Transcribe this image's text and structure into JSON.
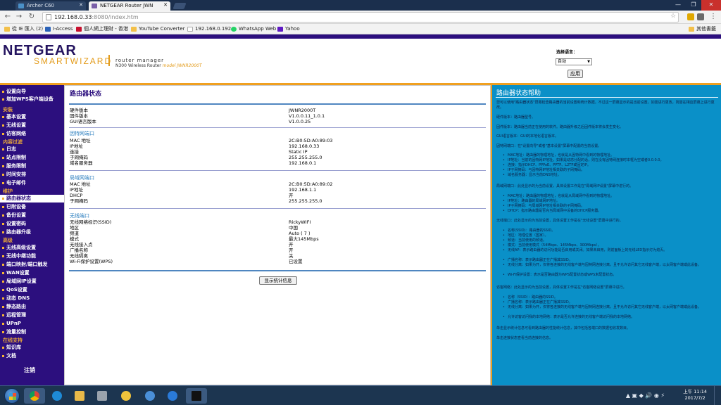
{
  "browser": {
    "tabs": [
      {
        "label": "Archer C60"
      },
      {
        "label": "NETGEAR Router JWN"
      }
    ],
    "url_host": "192.168.0.33",
    "url_path": ":8080/index.htm",
    "bookmarks": [
      {
        "label": "從 IE 匯入 (2)",
        "color": "#f3c04a"
      },
      {
        "label": "I-Access",
        "color": "#2b62b8"
      },
      {
        "label": "個人網上理財 - 香港",
        "color": "#c8102e"
      },
      {
        "label": "YouTube Converter",
        "color": "#f3c04a"
      },
      {
        "label": "192.168.0.192",
        "color": "#aaaaaa"
      },
      {
        "label": "WhatsApp Web",
        "color": "#25d366"
      },
      {
        "label": "Yahoo",
        "color": "#5f1ac4"
      },
      {
        "label": "其他書籤",
        "color": "#f3c04a"
      }
    ]
  },
  "router": {
    "brand": "NETGEAR",
    "sub_brand": "SMARTWIZARD",
    "tagline": "router manager",
    "model_desc": "N300 Wireless Router",
    "model_label": "model JWNR2000T",
    "language_label": "选择语言：",
    "language_value": "自动",
    "apply_label": "应用",
    "logout_label": "注销"
  },
  "sidebar": {
    "items": [
      {
        "label": "设置向导",
        "type": "item"
      },
      {
        "label": "增加WPS客户端设备",
        "type": "item"
      },
      {
        "label": "安装",
        "type": "head"
      },
      {
        "label": "基本设置",
        "type": "item"
      },
      {
        "label": "无线设置",
        "type": "item"
      },
      {
        "label": "访客网络",
        "type": "item"
      },
      {
        "label": "内容过滤",
        "type": "head"
      },
      {
        "label": "日志",
        "type": "item"
      },
      {
        "label": "站点限制",
        "type": "item"
      },
      {
        "label": "服务限制",
        "type": "item"
      },
      {
        "label": "时间安排",
        "type": "item"
      },
      {
        "label": "电子邮件",
        "type": "item"
      },
      {
        "label": "维护",
        "type": "head"
      },
      {
        "label": "路由器状态",
        "type": "item",
        "active": true
      },
      {
        "label": "已附设备",
        "type": "item"
      },
      {
        "label": "备份设置",
        "type": "item"
      },
      {
        "label": "设置密码",
        "type": "item"
      },
      {
        "label": "路由器升级",
        "type": "item"
      },
      {
        "label": "高级",
        "type": "head"
      },
      {
        "label": "无线高级设置",
        "type": "item"
      },
      {
        "label": "无线中继功能",
        "type": "item"
      },
      {
        "label": "端口映射/端口触发",
        "type": "item"
      },
      {
        "label": "WAN设置",
        "type": "item"
      },
      {
        "label": "局域网IP设置",
        "type": "item"
      },
      {
        "label": "QoS设置",
        "type": "item"
      },
      {
        "label": "动态 DNS",
        "type": "item"
      },
      {
        "label": "静态路由",
        "type": "item"
      },
      {
        "label": "远程管理",
        "type": "item"
      },
      {
        "label": "UPnP",
        "type": "item"
      },
      {
        "label": "流量控制",
        "type": "item"
      },
      {
        "label": "在线支持",
        "type": "head"
      },
      {
        "label": "知识库",
        "type": "item"
      },
      {
        "label": "文档",
        "type": "item"
      }
    ]
  },
  "main": {
    "title": "路由器状态",
    "info": [
      {
        "key": "硬件版本",
        "value": "JWNR2000T"
      },
      {
        "key": "固件版本",
        "value": "V1.0.0.11_1.0.1"
      },
      {
        "key": "GUI语言版本",
        "value": "V1.0.0.25"
      }
    ],
    "internet_title": "因特网端口",
    "internet": [
      {
        "key": "MAC 地址",
        "value": "2C:B0:5D:A0:89:03"
      },
      {
        "key": "IP地址",
        "value": "192.168.0.33"
      },
      {
        "key": "连接",
        "value": "Static IP"
      },
      {
        "key": "子网掩码",
        "value": "255.255.255.0"
      },
      {
        "key": "域名服务器",
        "value": "192.168.0.1"
      }
    ],
    "lan_title": "局域网端口",
    "lan": [
      {
        "key": "MAC 地址",
        "value": "2C:B0:5D:A0:89:02"
      },
      {
        "key": "IP地址",
        "value": "192.168.1.1"
      },
      {
        "key": "DHCP",
        "value": "开"
      },
      {
        "key": "子网掩码",
        "value": "255.255.255.0"
      }
    ],
    "wireless_title": "无线端口",
    "wireless": [
      {
        "key": "无线网络标识(SSID)",
        "value": "RickyWIFI"
      },
      {
        "key": "地区",
        "value": "中国"
      },
      {
        "key": "频道",
        "value": "Auto ( 7 )"
      },
      {
        "key": "模式",
        "value": "最大145Mbps"
      },
      {
        "key": "无线接入点",
        "value": "开"
      },
      {
        "key": "广播名称",
        "value": "开"
      },
      {
        "key": "无线隔离",
        "value": "关"
      },
      {
        "key": "Wi-Fi保护设置(WPS)",
        "value": "已设置"
      }
    ],
    "stats_button": "显示统计信息"
  },
  "help": {
    "title": "路由器状态帮助",
    "intro": "您可以使用\"路由器状态\"屏幕检查路由器的当前设置和统计数据。不过这一屏幕显示的是当前设置。如需进行更改，则需在相应屏幕上进行更改。",
    "hw": "硬件版本：路由器型号。",
    "fw": "固件版本：路由器当前正在使用的软件。路由器升级之后固件版本将会发生变化。",
    "gui": "GUI语言版本：GUI的本地化语言版本。",
    "internet_head": "因特网端口：在\"设置向导\"或者\"基本设置\"屏幕中配置的当前设置。",
    "internet_items": [
      "MAC地址：路由器的物理地址，也就是从因特网中看到的物理地址。",
      "IP地址：当前的因特网IP地址。如果是动态分配的话，则在没有因特网连接时本框为空或者0.0.0.0。",
      "连接：指示DHCP、PPPoE、PPTP、L2TP或固定IP。",
      "IP子网掩码：与因特网IP地址相关联的子网掩码。",
      "域名服务器：显示当前DNS地址。"
    ],
    "lan_head": "局域网端口：此处显示的为当前设置，具体设置工作是在\"局域网IP设置\"屏幕中进行的。",
    "lan_items": [
      "MAC地址：路由器的物理地址，也就是从局域网中看到的物理地址。",
      "IP地址：路由器的局域网IP地址。",
      "IP子网掩码：与局域网IP地址相关联的子网掩码。",
      "DHCP：指示路由器是否充当局域网中设备的DHCP服务器。"
    ],
    "wlan_head": "无线端口：此处显示的为当前设置，具体设置工作是在\"无线设置\"屏幕中进行的。",
    "wlan_items": [
      "名称(SSID)：路由器的SSID。",
      "地区：地理位置（国家）。",
      "频道：当前使用的频道。",
      "模式：当前使用模式（54Mbps、145Mbps、300Mbps）。",
      "无线AP：表示路由器的访问功能是否启用或关闭。如果未启用，则前面板上的无线LED指示灯为熄灭。",
      "广播名称：表示路由器正在广播其SSID。",
      "无线分离：如果为开，仅将各连接的无线客户端与因特网连接分离，且不允许访问其它无线客户端，以太网客户端或此设备。",
      "Wi-Fi保护设置：表示是否路由器为WPS配置状态或WPS未配置状态。"
    ],
    "guest_head": "访客网络：此处显示的为当前设置，具体设置工作是在\"访客网络设置\"屏幕中进行。",
    "guest_items": [
      "名称（SSID）：路由器的SSID。",
      "广播名称：表示路由器正在广播其SSID。",
      "无线分离：如果为开，仅将各连接的无线客户端与因特网连接分离，且不允许访问其它无线客户端，以太网客户端或此设备。",
      "允许访客访问我的本地网络：表示是否允许连接的无线客户端访问我的本地网络。"
    ],
    "stats_note": "单击显示统计信息可看到路由器的性能统计信息，其中包括各端口的数据包收发数目。",
    "conn_note": "单击连接状态查看当前连接的信息。"
  },
  "taskbar": {
    "tray": "▲ ▣ ◆ 🔊 ◉ ⚡",
    "time": "上午 11:14",
    "date": "2017/7/2"
  }
}
